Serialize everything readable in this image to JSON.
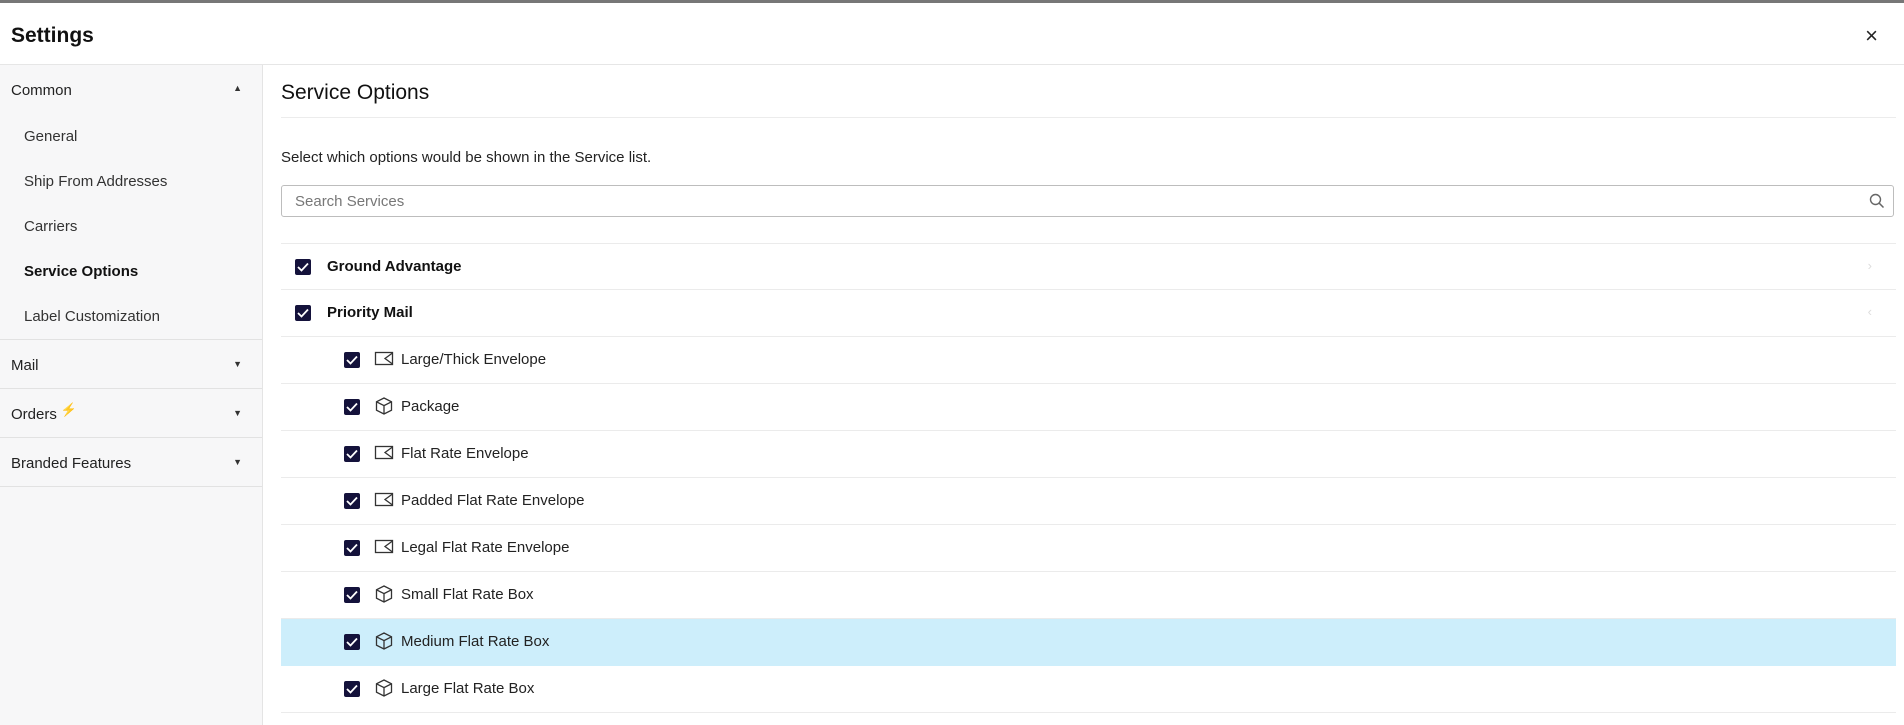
{
  "header": {
    "title": "Settings",
    "close_glyph": "×"
  },
  "sidebar": {
    "common": {
      "label": "Common",
      "items": [
        "General",
        "Ship From Addresses",
        "Carriers",
        "Service Options",
        "Label Customization"
      ]
    },
    "mail": {
      "label": "Mail"
    },
    "orders": {
      "label": "Orders"
    },
    "branded": {
      "label": "Branded Features"
    }
  },
  "main": {
    "title": "Service Options",
    "description": "Select which options would be shown in the Service list.",
    "search": {
      "placeholder": "Search Services"
    },
    "groups": [
      {
        "label": "Ground Advantage",
        "checked": true,
        "expanded": false
      },
      {
        "label": "Priority Mail",
        "checked": true,
        "expanded": true
      }
    ],
    "items": [
      {
        "label": "Large/Thick Envelope",
        "icon": "envelope-icon",
        "checked": true
      },
      {
        "label": "Package",
        "icon": "box-icon",
        "checked": true
      },
      {
        "label": "Flat Rate Envelope",
        "icon": "envelope-icon",
        "checked": true
      },
      {
        "label": "Padded Flat Rate Envelope",
        "icon": "envelope-icon",
        "checked": true
      },
      {
        "label": "Legal Flat Rate Envelope",
        "icon": "envelope-icon",
        "checked": true
      },
      {
        "label": "Small Flat Rate Box",
        "icon": "box-icon",
        "checked": true
      },
      {
        "label": "Medium Flat Rate Box",
        "icon": "box-icon",
        "checked": true,
        "highlighted": true
      },
      {
        "label": "Large Flat Rate Box",
        "icon": "box-icon",
        "checked": true
      }
    ]
  },
  "colors": {
    "checkbox": "#14123b",
    "highlight": "#cdeefb",
    "accent_bolt": "#8b3cf4"
  }
}
